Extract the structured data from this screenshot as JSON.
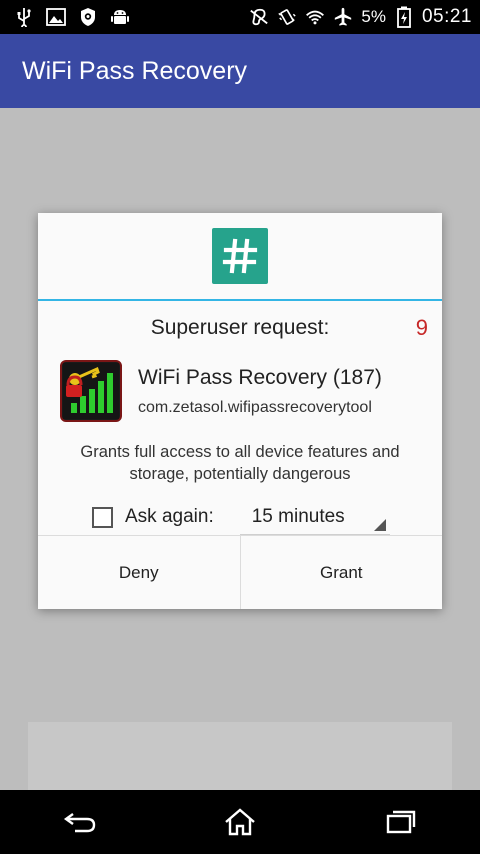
{
  "status_bar": {
    "battery_text": "5%",
    "time": "05:21",
    "icons_left": [
      "usb-icon",
      "image-icon",
      "shield-icon",
      "android-icon"
    ],
    "icons_right": [
      "hearing-icon",
      "vibrate-icon",
      "wifi-icon",
      "airplane-icon",
      "battery-icon"
    ]
  },
  "app_bar": {
    "title": "WiFi Pass Recovery"
  },
  "dialog": {
    "logo_symbol": "#",
    "title": "Superuser request:",
    "countdown": "9",
    "app_name": "WiFi Pass Recovery (187)",
    "package": "com.zetasol.wifipassrecoverytool",
    "description": "Grants full access to all device features and storage, potentially dangerous",
    "ask_again_label": "Ask again:",
    "ask_again_checked": false,
    "duration": "15 minutes",
    "deny_label": "Deny",
    "grant_label": "Grant"
  },
  "nav_bar": {
    "buttons": [
      "back-icon",
      "home-icon",
      "recents-icon"
    ]
  },
  "colors": {
    "app_bar": "#3949a3",
    "logo": "#26a38c",
    "divider": "#33b5e5",
    "countdown": "#c62828",
    "background": "#bdbdbd"
  }
}
